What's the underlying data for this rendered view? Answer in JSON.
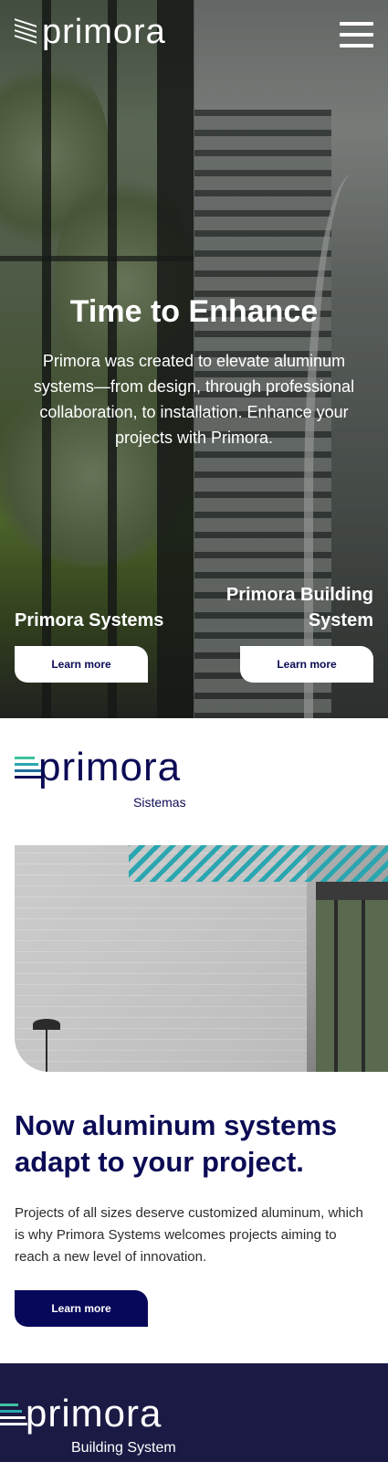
{
  "brand": {
    "logo_text": "primora",
    "logo_sub_systems": "Sistemas",
    "logo_sub_building": "Building System"
  },
  "header": {
    "menu_icon": "hamburger-menu-icon"
  },
  "hero": {
    "title": "Time to Enhance",
    "text": "Primora was created to elevate aluminum systems—from design, through professional collaboration, to installation. Enhance your projects with Primora.",
    "cards": [
      {
        "label": "Primora Systems",
        "button": "Learn more"
      },
      {
        "label": "Primora Building System",
        "button": "Learn more"
      }
    ]
  },
  "systems_section": {
    "title": "Now aluminum systems adapt to your project.",
    "text": "Projects of all sizes deserve customized aluminum, which is why Primora Systems welcomes projects aiming to reach a new level of innovation.",
    "button": "Learn more"
  },
  "colors": {
    "navy": "#0b0b55",
    "accent_teal": "#2aa6b0",
    "accent_green": "#3cc1a0",
    "band": "#1b1a44"
  }
}
